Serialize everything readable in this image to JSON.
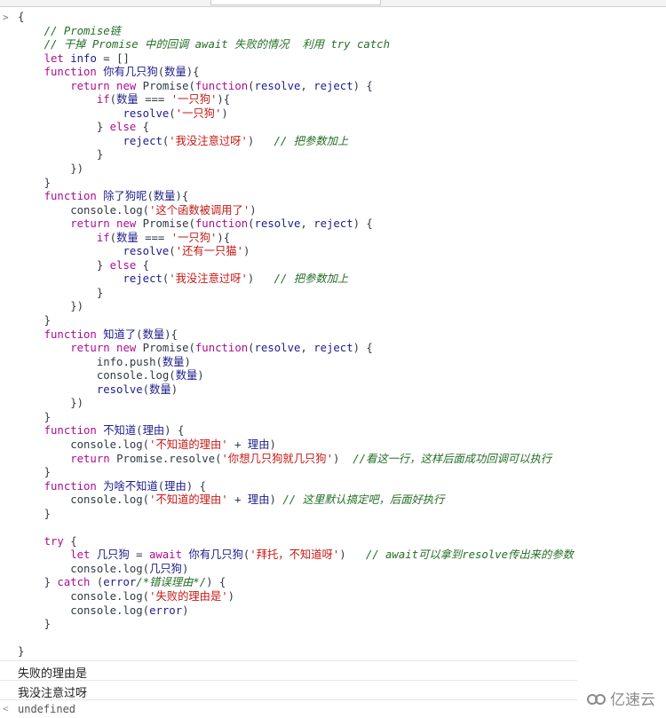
{
  "console": {
    "prompt_icon": "chevron-right-icon",
    "code_lines": [
      [
        [
          "p",
          "{"
        ]
      ],
      [
        [
          "c",
          "    // Promise链"
        ]
      ],
      [
        [
          "c",
          "    // 干掉 Promise 中的回调 await 失败的情况  利用 try catch"
        ]
      ],
      [
        [
          "k",
          "    let "
        ],
        [
          "v",
          "info"
        ],
        [
          "p",
          " = []"
        ]
      ],
      [
        [
          "k",
          "    function "
        ],
        [
          "v",
          "你有几只狗"
        ],
        [
          "p",
          "("
        ],
        [
          "v",
          "数量"
        ],
        [
          "p",
          "){"
        ]
      ],
      [
        [
          "k",
          "        return new "
        ],
        [
          "p",
          "Promise("
        ],
        [
          "k",
          "function"
        ],
        [
          "p",
          "("
        ],
        [
          "v",
          "resolve"
        ],
        [
          "p",
          ", "
        ],
        [
          "v",
          "reject"
        ],
        [
          "p",
          ") {"
        ]
      ],
      [
        [
          "k",
          "            if"
        ],
        [
          "p",
          "("
        ],
        [
          "v",
          "数量"
        ],
        [
          "p",
          " === "
        ],
        [
          "s",
          "'一只狗'"
        ],
        [
          "p",
          "){"
        ]
      ],
      [
        [
          "v",
          "                resolve"
        ],
        [
          "p",
          "("
        ],
        [
          "s",
          "'一只狗'"
        ],
        [
          "p",
          ")"
        ]
      ],
      [
        [
          "p",
          "            } "
        ],
        [
          "k",
          "else"
        ],
        [
          "p",
          " {"
        ]
      ],
      [
        [
          "v",
          "                reject"
        ],
        [
          "p",
          "("
        ],
        [
          "s",
          "'我没注意过呀'"
        ],
        [
          "p",
          ")   "
        ],
        [
          "c",
          "// 把参数加上"
        ]
      ],
      [
        [
          "p",
          "            }"
        ]
      ],
      [
        [
          "p",
          "        })"
        ]
      ],
      [
        [
          "p",
          "    }"
        ]
      ],
      [
        [
          "k",
          "    function "
        ],
        [
          "v",
          "除了狗呢"
        ],
        [
          "p",
          "("
        ],
        [
          "v",
          "数量"
        ],
        [
          "p",
          "){"
        ]
      ],
      [
        [
          "p",
          "        console.log("
        ],
        [
          "s",
          "'这个函数被调用了'"
        ],
        [
          "p",
          ")"
        ]
      ],
      [
        [
          "k",
          "        return new "
        ],
        [
          "p",
          "Promise("
        ],
        [
          "k",
          "function"
        ],
        [
          "p",
          "("
        ],
        [
          "v",
          "resolve"
        ],
        [
          "p",
          ", "
        ],
        [
          "v",
          "reject"
        ],
        [
          "p",
          ") {"
        ]
      ],
      [
        [
          "k",
          "            if"
        ],
        [
          "p",
          "("
        ],
        [
          "v",
          "数量"
        ],
        [
          "p",
          " === "
        ],
        [
          "s",
          "'一只狗'"
        ],
        [
          "p",
          "){"
        ]
      ],
      [
        [
          "v",
          "                resolve"
        ],
        [
          "p",
          "("
        ],
        [
          "s",
          "'还有一只猫'"
        ],
        [
          "p",
          ")"
        ]
      ],
      [
        [
          "p",
          "            } "
        ],
        [
          "k",
          "else"
        ],
        [
          "p",
          " {"
        ]
      ],
      [
        [
          "v",
          "                reject"
        ],
        [
          "p",
          "("
        ],
        [
          "s",
          "'我没注意过呀'"
        ],
        [
          "p",
          ")   "
        ],
        [
          "c",
          "// 把参数加上"
        ]
      ],
      [
        [
          "p",
          "            }"
        ]
      ],
      [
        [
          "p",
          "        })"
        ]
      ],
      [
        [
          "p",
          "    }"
        ]
      ],
      [
        [
          "k",
          "    function "
        ],
        [
          "v",
          "知道了"
        ],
        [
          "p",
          "("
        ],
        [
          "v",
          "数量"
        ],
        [
          "p",
          "){"
        ]
      ],
      [
        [
          "k",
          "        return new "
        ],
        [
          "p",
          "Promise("
        ],
        [
          "k",
          "function"
        ],
        [
          "p",
          "("
        ],
        [
          "v",
          "resolve"
        ],
        [
          "p",
          ", "
        ],
        [
          "v",
          "reject"
        ],
        [
          "p",
          ") {"
        ]
      ],
      [
        [
          "p",
          "            info.push("
        ],
        [
          "v",
          "数量"
        ],
        [
          "p",
          ")"
        ]
      ],
      [
        [
          "p",
          "            console.log("
        ],
        [
          "v",
          "数量"
        ],
        [
          "p",
          ")"
        ]
      ],
      [
        [
          "v",
          "            resolve"
        ],
        [
          "p",
          "("
        ],
        [
          "v",
          "数量"
        ],
        [
          "p",
          ")"
        ]
      ],
      [
        [
          "p",
          "        })"
        ]
      ],
      [
        [
          "p",
          "    }"
        ]
      ],
      [
        [
          "k",
          "    function "
        ],
        [
          "v",
          "不知道"
        ],
        [
          "p",
          "("
        ],
        [
          "v",
          "理由"
        ],
        [
          "p",
          ") {"
        ]
      ],
      [
        [
          "p",
          "        console.log("
        ],
        [
          "s",
          "'不知道的理由'"
        ],
        [
          "p",
          " + "
        ],
        [
          "v",
          "理由"
        ],
        [
          "p",
          ")"
        ]
      ],
      [
        [
          "k",
          "        return "
        ],
        [
          "p",
          "Promise.resolve("
        ],
        [
          "s",
          "'你想几只狗就几只狗'"
        ],
        [
          "p",
          ")  "
        ],
        [
          "c",
          "//看这一行，这样后面成功回调可以执行"
        ]
      ],
      [
        [
          "p",
          "    }"
        ]
      ],
      [
        [
          "k",
          "    function "
        ],
        [
          "v",
          "为啥不知道"
        ],
        [
          "p",
          "("
        ],
        [
          "v",
          "理由"
        ],
        [
          "p",
          ") {"
        ]
      ],
      [
        [
          "p",
          "        console.log("
        ],
        [
          "s",
          "'不知道的理由'"
        ],
        [
          "p",
          " + "
        ],
        [
          "v",
          "理由"
        ],
        [
          "p",
          ") "
        ],
        [
          "c",
          "// 这里默认搞定吧，后面好执行"
        ]
      ],
      [
        [
          "p",
          "    }"
        ]
      ],
      [
        [
          "p",
          " "
        ]
      ],
      [
        [
          "k",
          "    try"
        ],
        [
          "p",
          " {"
        ]
      ],
      [
        [
          "k",
          "        let "
        ],
        [
          "v",
          "几只狗"
        ],
        [
          "p",
          " = "
        ],
        [
          "k",
          "await "
        ],
        [
          "v",
          "你有几只狗"
        ],
        [
          "p",
          "("
        ],
        [
          "s",
          "'拜托，不知道呀'"
        ],
        [
          "p",
          ")   "
        ],
        [
          "c",
          "// await可以拿到resolve传出来的参数"
        ]
      ],
      [
        [
          "p",
          "        console.log("
        ],
        [
          "v",
          "几只狗"
        ],
        [
          "p",
          ")"
        ]
      ],
      [
        [
          "p",
          "    } "
        ],
        [
          "k",
          "catch"
        ],
        [
          "p",
          " ("
        ],
        [
          "v",
          "error"
        ],
        [
          "c",
          "/*错误理由*/"
        ],
        [
          "p",
          ") {"
        ]
      ],
      [
        [
          "p",
          "        console.log("
        ],
        [
          "s",
          "'失败的理由是'"
        ],
        [
          "p",
          ")"
        ]
      ],
      [
        [
          "p",
          "        console.log("
        ],
        [
          "v",
          "error"
        ],
        [
          "p",
          ")"
        ]
      ],
      [
        [
          "p",
          "    }"
        ]
      ],
      [
        [
          "p",
          " "
        ]
      ],
      [
        [
          "p",
          "}"
        ]
      ]
    ],
    "output_lines": [
      "失败的理由是",
      "我没注意过呀"
    ],
    "result_icon": "chevron-left-icon",
    "result": "undefined"
  },
  "watermark": {
    "text": "亿速云"
  },
  "colors": {
    "keyword": "#aa0d91",
    "string": "#c41a16",
    "comment": "#236e25",
    "identifier": "#1c1c8c"
  }
}
